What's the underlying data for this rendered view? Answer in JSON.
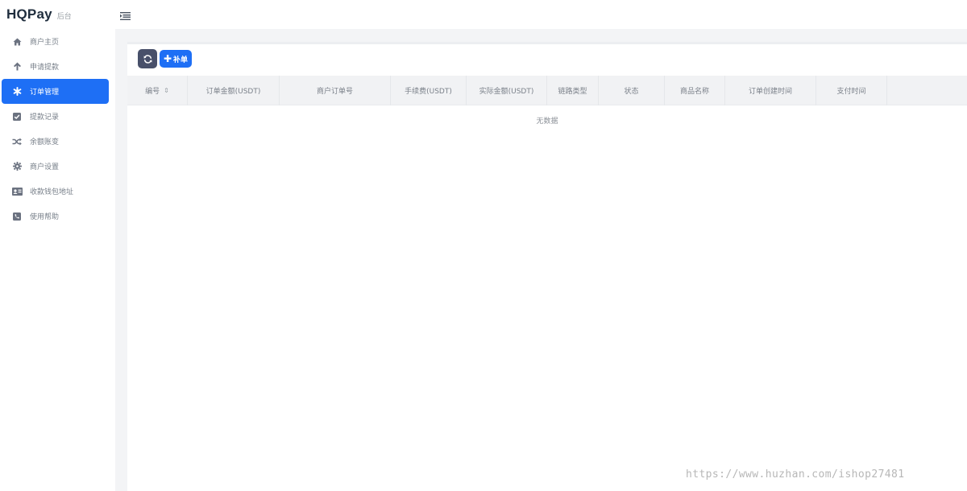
{
  "brand": {
    "name": "HQPay",
    "sub": "后台"
  },
  "sidebar": {
    "items": [
      {
        "label": "商户主页",
        "icon": "home-icon",
        "active": false
      },
      {
        "label": "申请提款",
        "icon": "arrow-up-icon",
        "active": false
      },
      {
        "label": "订单管理",
        "icon": "asterisk-icon",
        "active": true
      },
      {
        "label": "提款记录",
        "icon": "check-square-icon",
        "active": false
      },
      {
        "label": "余额账变",
        "icon": "shuffle-icon",
        "active": false
      },
      {
        "label": "商户设置",
        "icon": "gear-icon",
        "active": false
      },
      {
        "label": "收款钱包地址",
        "icon": "id-card-icon",
        "active": false
      },
      {
        "label": "使用帮助",
        "icon": "phone-square-icon",
        "active": false
      }
    ]
  },
  "toolbar": {
    "add_label": "补单"
  },
  "table": {
    "columns": [
      "编号",
      "订单金额(USDT)",
      "商户订单号",
      "手续费(USDT)",
      "实际金额(USDT)",
      "链路类型",
      "状态",
      "商品名称",
      "订单创建时间",
      "支付时间"
    ],
    "empty_text": "无数据"
  },
  "watermark": "https://www.huzhan.com/ishop27481",
  "colors": {
    "accent": "#1e6ff5",
    "refresh_button": "#48506a",
    "content_bg": "#f3f4f6"
  }
}
